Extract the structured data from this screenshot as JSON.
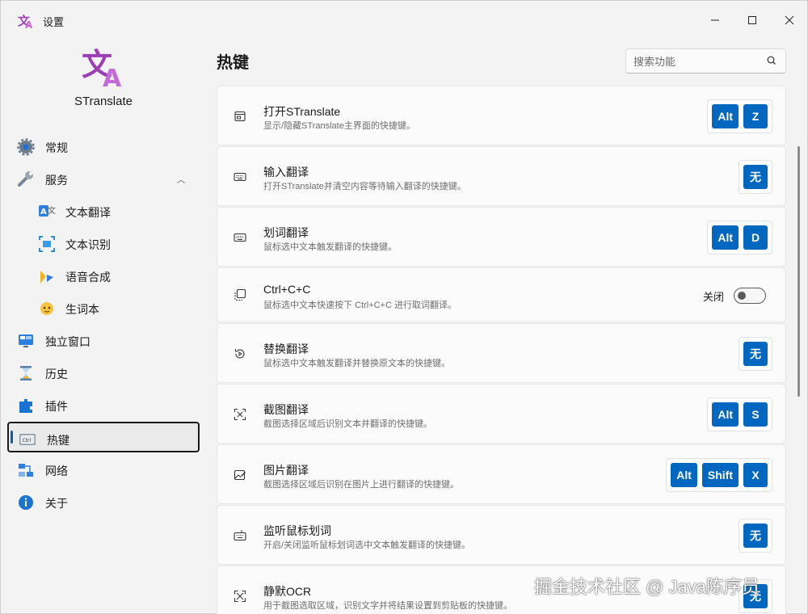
{
  "window": {
    "title": "设置"
  },
  "brand": {
    "name": "STranslate",
    "accent": "#9b3fb5"
  },
  "sidebar": {
    "items": [
      {
        "label": "常规",
        "icon": "gear-icon"
      },
      {
        "label": "服务",
        "icon": "wrench-icon",
        "expanded": true
      },
      {
        "label": "文本翻译",
        "icon": "text-translate-icon",
        "sub": true
      },
      {
        "label": "文本识别",
        "icon": "ocr-icon",
        "sub": true
      },
      {
        "label": "语音合成",
        "icon": "tts-icon",
        "sub": true
      },
      {
        "label": "生词本",
        "icon": "vocabulary-icon",
        "sub": true
      },
      {
        "label": "独立窗口",
        "icon": "window-icon"
      },
      {
        "label": "历史",
        "icon": "hourglass-icon"
      },
      {
        "label": "插件",
        "icon": "plugin-icon"
      },
      {
        "label": "热键",
        "icon": "ctrl-key-icon",
        "active": true
      },
      {
        "label": "网络",
        "icon": "network-icon"
      },
      {
        "label": "关于",
        "icon": "info-icon"
      }
    ]
  },
  "main": {
    "title": "热键",
    "search_placeholder": "搜索功能",
    "rows": [
      {
        "title": "打开STranslate",
        "desc": "显示/隐藏STranslate主界面的快捷键。",
        "icon": "window-icon",
        "keys": [
          "Alt",
          "Z"
        ]
      },
      {
        "title": "输入翻译",
        "desc": "打开STranslate并清空内容等待输入翻译的快捷键。",
        "icon": "keyboard-icon",
        "keys": [
          "无"
        ]
      },
      {
        "title": "划词翻译",
        "desc": "鼠标选中文本触发翻译的快捷键。",
        "icon": "keyboard-icon",
        "keys": [
          "Alt",
          "D"
        ]
      },
      {
        "title": "Ctrl+C+C",
        "desc": "鼠标选中文本快速按下 Ctrl+C+C 进行取词翻译。",
        "icon": "copy-icon",
        "toggle": {
          "label": "关闭",
          "on": false
        }
      },
      {
        "title": "替换翻译",
        "desc": "鼠标选中文本触发翻译并替换原文本的快捷键。",
        "icon": "replace-icon",
        "keys": [
          "无"
        ]
      },
      {
        "title": "截图翻译",
        "desc": "截图选择区域后识别文本并翻译的快捷键。",
        "icon": "screenshot-icon",
        "keys": [
          "Alt",
          "S"
        ]
      },
      {
        "title": "图片翻译",
        "desc": "截图选择区域后识别在图片上进行翻译的快捷键。",
        "icon": "image-edit-icon",
        "keys": [
          "Alt",
          "Shift",
          "X"
        ]
      },
      {
        "title": "监听鼠标划词",
        "desc": "开启/关闭监听鼠标划词选中文本触发翻译的快捷键。",
        "icon": "mouse-keyboard-icon",
        "keys": [
          "无"
        ]
      },
      {
        "title": "静默OCR",
        "desc": "用于截图选取区域，识别文字并将结果设置到剪贴板的快捷键。",
        "icon": "expand-icon",
        "keys": [
          "无"
        ]
      }
    ]
  },
  "watermark": "掘金技术社区 @ Java陈序员",
  "colors": {
    "key_bg": "#0067c0",
    "active_bar": "#005fb8"
  }
}
